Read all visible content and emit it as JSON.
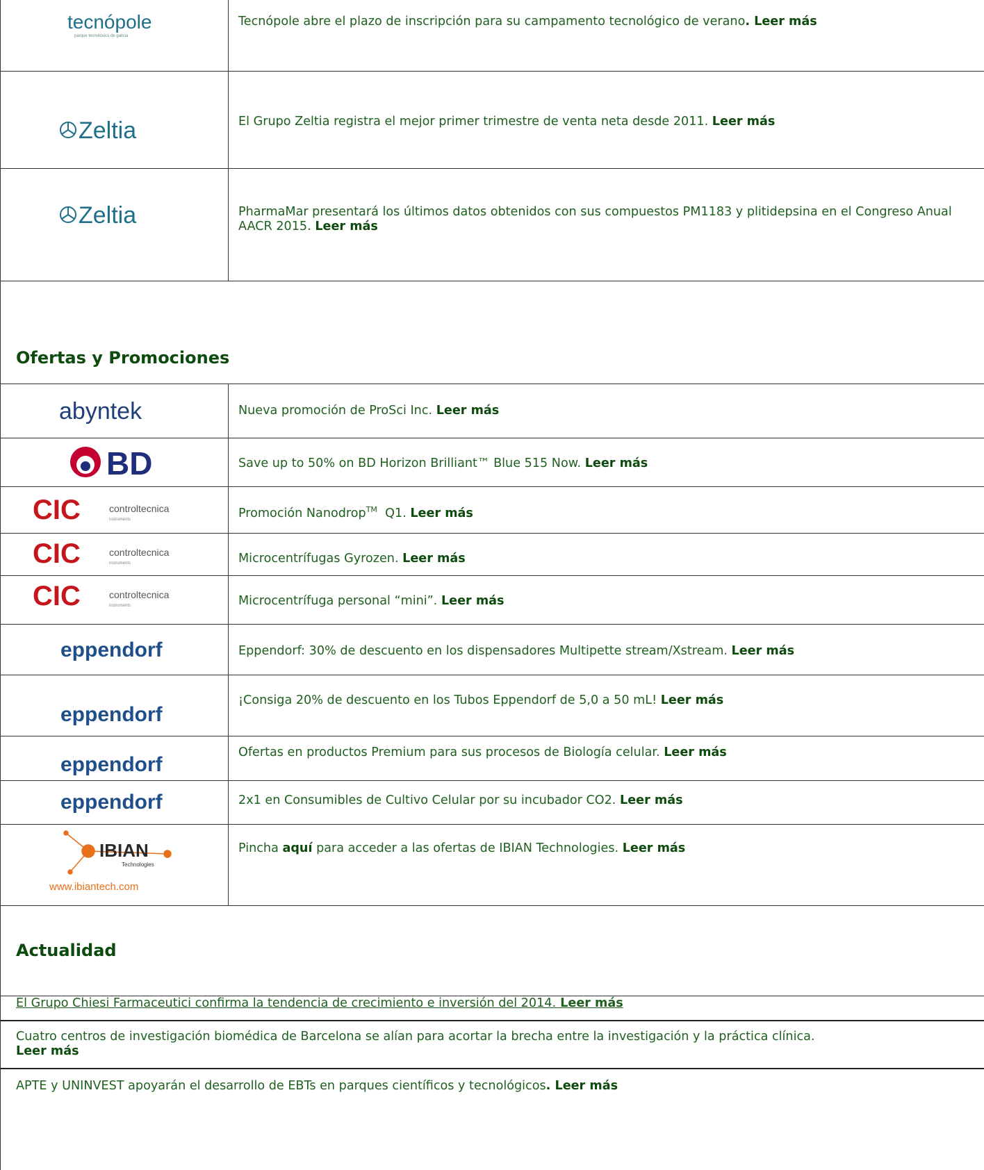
{
  "colors": {
    "text": "#1f5f1f",
    "heading": "#0d4a0d",
    "border": "#333333",
    "brand_teal": "#1f6f8a",
    "bd_blue": "#1f2d7a",
    "eppendorf_blue": "#1f4f8a",
    "cic_red": "#c4161c",
    "ibian_orange": "#e8701a"
  },
  "news": [
    {
      "logo": "tecnopole-logo",
      "logo_text": "tecnópole",
      "logo_sub": "parque tecnolóxico de galicia",
      "text": "Tecnópole abre el plazo de inscripción para su campamento tecnológico de verano",
      "more": ". Leer más"
    },
    {
      "logo": "zeltia-logo",
      "logo_text": "Zeltia",
      "text": "El Grupo Zeltia registra el mejor primer trimestre de venta neta desde 2011. ",
      "more": "Leer más"
    },
    {
      "logo": "zeltia-logo",
      "logo_text": "Zeltia",
      "text": "PharmaMar presentará los últimos datos obtenidos con sus compuestos PM1183 y plitidepsina en el Congreso Anual AACR 2015. ",
      "more": "Leer más"
    }
  ],
  "offers_heading": "Ofertas y Promociones",
  "offers": [
    {
      "logo": "abyntek-logo",
      "logo_text": "abyntek",
      "text": "Nueva promoción de ProSci Inc. ",
      "more": "Leer más"
    },
    {
      "logo": "bd-logo",
      "logo_text": "BD",
      "text": "Save up to 50% on BD Horizon Brilliant™ Blue 515 Now. ",
      "more": "Leer más"
    },
    {
      "logo": "controltecnica-logo",
      "logo_text": "controltecnica",
      "logo_sub": "instruments",
      "text": "Promoción Nanodrop",
      "sup": "TM",
      "text2": "  Q1. ",
      "more": "Leer más"
    },
    {
      "logo": "controltecnica-logo",
      "logo_text": "controltecnica",
      "logo_sub": "instruments",
      "text": "Microcentrífugas Gyrozen. ",
      "more": "Leer más"
    },
    {
      "logo": "controltecnica-logo",
      "logo_text": "controltecnica",
      "logo_sub": "instruments",
      "text": "Microcentrífuga personal “mini”. ",
      "more": "Leer más"
    },
    {
      "logo": "eppendorf-logo",
      "logo_text": "eppendorf",
      "text": "Eppendorf: 30% de descuento en los dispensadores Multipette stream/Xstream. ",
      "more": "Leer más"
    },
    {
      "logo": "eppendorf-logo",
      "logo_text": "eppendorf",
      "text": "¡Consiga 20% de descuento en los Tubos Eppendorf de 5,0 a 50 mL! ",
      "more": "Leer más"
    },
    {
      "logo": "eppendorf-logo",
      "logo_text": "eppendorf",
      "text": "Ofertas en productos Premium para sus procesos de Biología celular. ",
      "more": "Leer más"
    },
    {
      "logo": "eppendorf-logo",
      "logo_text": "eppendorf",
      "text": "2x1 en Consumibles de Cultivo Celular por su incubador CO2. ",
      "more": "Leer más"
    },
    {
      "logo": "ibian-logo",
      "logo_text": "IBIAN",
      "logo_sub": "Technologies",
      "logo_url": "www.ibiantech.com",
      "text": "Pincha ",
      "bold": "aquí",
      "text2": " para acceder a las ofertas de IBIAN Technologies. ",
      "more": "Leer más"
    }
  ],
  "news2_heading": "Actualidad",
  "news2": [
    {
      "text": "El Grupo Chiesi Farmaceutici confirma la tendencia de crecimiento e inversión del 2014.",
      "more": " Leer más"
    },
    {
      "text": "Cuatro centros de investigación biomédica de Barcelona se alían para acortar la brecha entre la investigación y la práctica clínica.",
      "more": "Leer más"
    },
    {
      "text": "APTE y UNINVEST apoyarán el desarrollo de EBTs en parques científicos y tecnológicos",
      "more": ". Leer más"
    }
  ]
}
